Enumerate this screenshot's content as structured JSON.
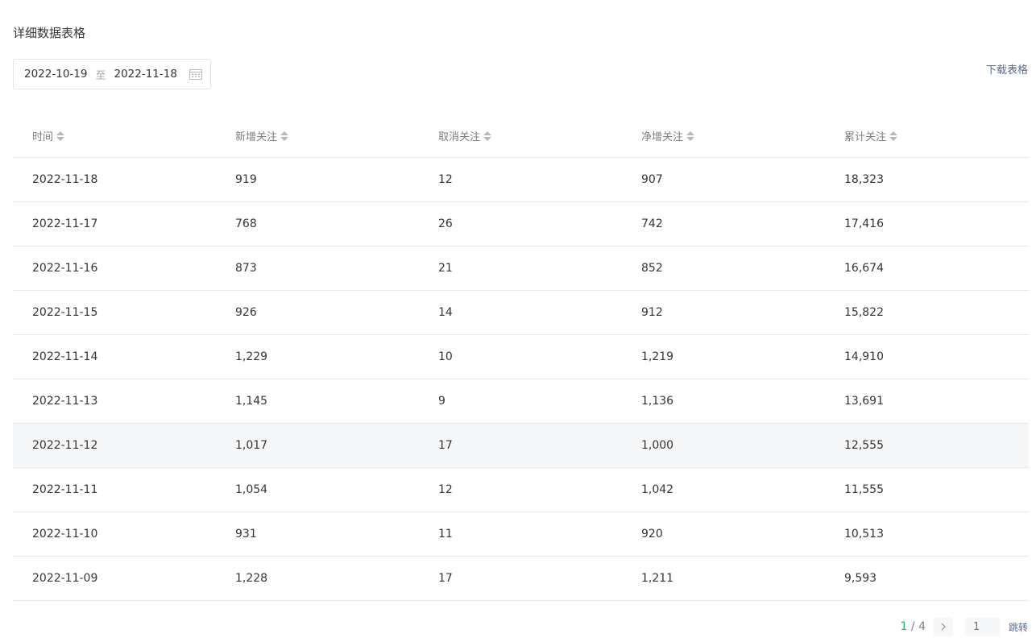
{
  "title": "详细数据表格",
  "date_range": {
    "start": "2022-10-19",
    "separator": "至",
    "end": "2022-11-18"
  },
  "download_label": "下载表格",
  "table": {
    "columns": [
      "时间",
      "新增关注",
      "取消关注",
      "净增关注",
      "累计关注"
    ],
    "rows": [
      [
        "2022-11-18",
        "919",
        "12",
        "907",
        "18,323"
      ],
      [
        "2022-11-17",
        "768",
        "26",
        "742",
        "17,416"
      ],
      [
        "2022-11-16",
        "873",
        "21",
        "852",
        "16,674"
      ],
      [
        "2022-11-15",
        "926",
        "14",
        "912",
        "15,822"
      ],
      [
        "2022-11-14",
        "1,229",
        "10",
        "1,219",
        "14,910"
      ],
      [
        "2022-11-13",
        "1,145",
        "9",
        "1,136",
        "13,691"
      ],
      [
        "2022-11-12",
        "1,017",
        "17",
        "1,000",
        "12,555"
      ],
      [
        "2022-11-11",
        "1,054",
        "12",
        "1,042",
        "11,555"
      ],
      [
        "2022-11-10",
        "931",
        "11",
        "920",
        "10,513"
      ],
      [
        "2022-11-09",
        "1,228",
        "17",
        "1,211",
        "9,593"
      ]
    ]
  },
  "pagination": {
    "current": "1",
    "separator": " / ",
    "total": "4",
    "input_placeholder": "1",
    "jump_label": "跳转"
  },
  "colors": {
    "accent": "#07c160",
    "link": "#576b95",
    "hover_row": "#f6f7f9"
  }
}
